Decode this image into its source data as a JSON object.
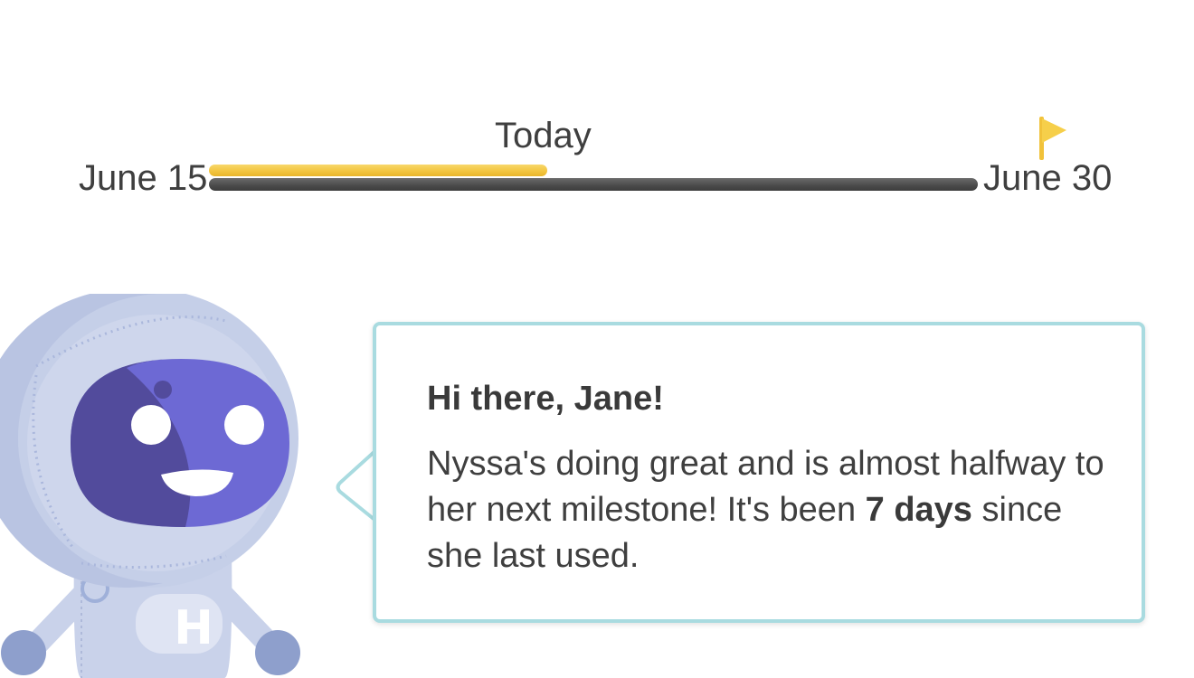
{
  "timeline": {
    "start_label": "June 15",
    "end_label": "June 30",
    "today_label": "Today",
    "progress_fraction": 0.44,
    "track_color": "#4a4a4a",
    "progress_color": "#f2c43d",
    "flag_color": "#f4c93f",
    "goal_icon": "flag-icon"
  },
  "message": {
    "greeting": "Hi there, Jane!",
    "body_part1": "Nyssa's doing great and is almost halfway to her next milestone! It's been ",
    "highlight": "7 days",
    "body_part2": " since she last used.",
    "border_color": "#a9dbe0"
  },
  "mascot": {
    "icon": "astronaut-mascot-icon",
    "chest_letter": "H",
    "visor_color": "#6d69d4",
    "suit_color": "#c9d2ea"
  }
}
